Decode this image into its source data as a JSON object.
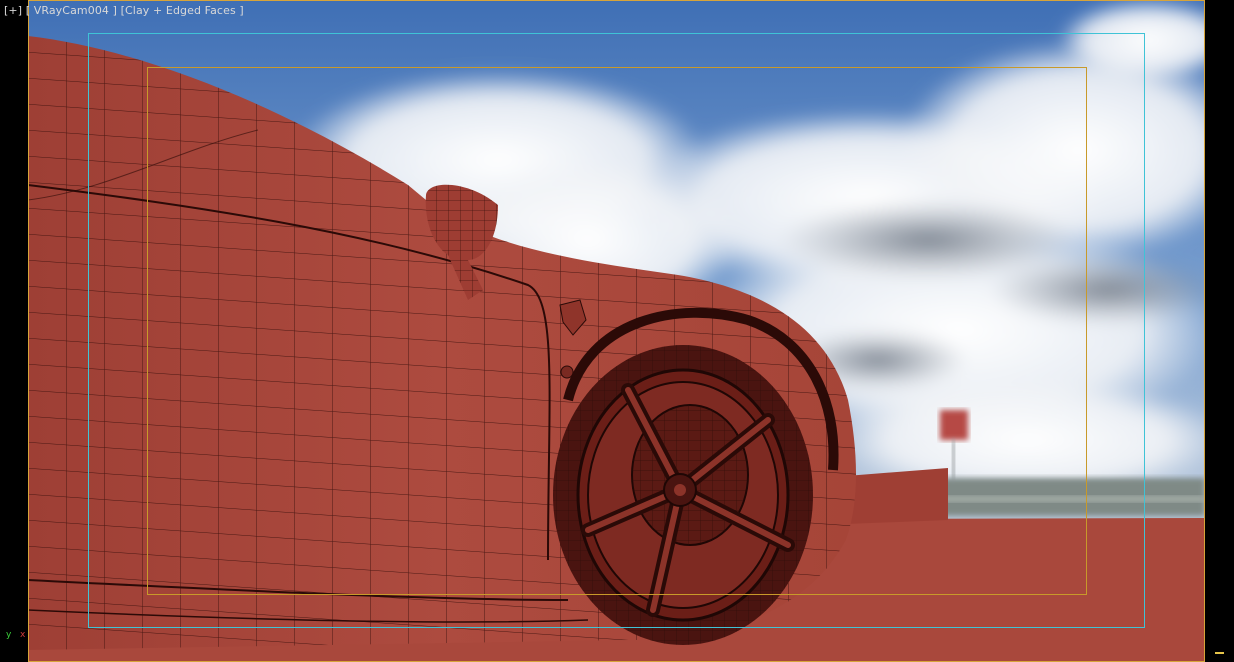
{
  "viewport": {
    "label_plus": "[+]",
    "label_camera": "[ VRayCam004 ]",
    "label_shading": "[Clay + Edged Faces ]",
    "axis_y": "y",
    "axis_x": "x"
  },
  "colors": {
    "clay": "#a9463c",
    "wire": "#3a0f0c",
    "safe_frame_outer": "#3fc3d6",
    "safe_frame_inner": "#c89a2a",
    "render_frame": "#d7a43a"
  }
}
